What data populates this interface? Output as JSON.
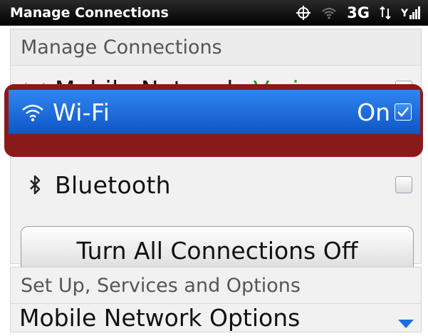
{
  "status_bar": {
    "title": "Manage Connections",
    "network_type": "3G",
    "icons": [
      "gps-icon",
      "wifi-signal-icon",
      "data-arrows-icon",
      "cell-signal-icon"
    ]
  },
  "connections": {
    "header": "Manage Connections",
    "items": [
      {
        "label": "Mobile Network",
        "value": "Veriz...",
        "checked": true,
        "icon": "antenna-icon"
      },
      {
        "label": "Wi-Fi",
        "value": "On",
        "checked": true,
        "icon": "wifi-icon",
        "highlighted": true
      },
      {
        "label": "Bluetooth",
        "value": "",
        "checked": false,
        "icon": "bluetooth-icon"
      }
    ],
    "turn_all_off_label": "Turn All Connections Off"
  },
  "services": {
    "header": "Set Up, Services and Options",
    "first_item": "Mobile Network Options"
  },
  "colors": {
    "highlight_blue": "#1b6ee0",
    "annotation_red": "#8a1a1a",
    "carrier_green": "#2a9b2a"
  }
}
